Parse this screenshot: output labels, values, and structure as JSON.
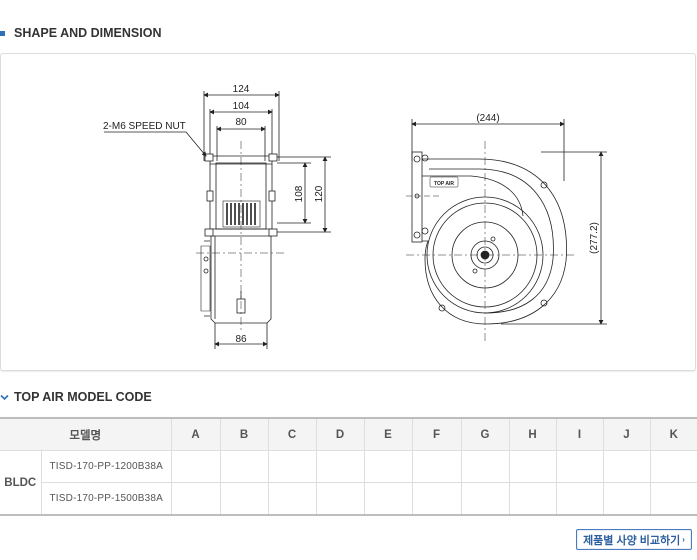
{
  "shape_section": {
    "title": "SHAPE AND DIMENSION"
  },
  "drawing": {
    "side_view": {
      "nut_label": "2-M6 SPEED NUT",
      "dim_124": "124",
      "dim_104": "104",
      "dim_80": "80",
      "dim_108": "108",
      "dim_120": "120",
      "dim_86": "86"
    },
    "front_view": {
      "dim_width": "(244)",
      "dim_height": "(277.2)",
      "logo_text": "TOP AIR"
    }
  },
  "model_section": {
    "title": "TOP AIR MODEL CODE"
  },
  "model_table": {
    "header_model": "모델명",
    "columns": [
      "A",
      "B",
      "C",
      "D",
      "E",
      "F",
      "G",
      "H",
      "I",
      "J",
      "K"
    ],
    "group": "BLDC",
    "rows": [
      {
        "model": "TISD-170-PP-1200B38A"
      },
      {
        "model": "TISD-170-PP-1500B38A"
      }
    ]
  },
  "compare_button": {
    "label": "제품별 사양 비교하기",
    "arrow": "›"
  },
  "colors": {
    "accent_blue": "#2f6fb6",
    "button_border": "#4b7bbf",
    "table_header_bg": "#f4f4f4"
  }
}
